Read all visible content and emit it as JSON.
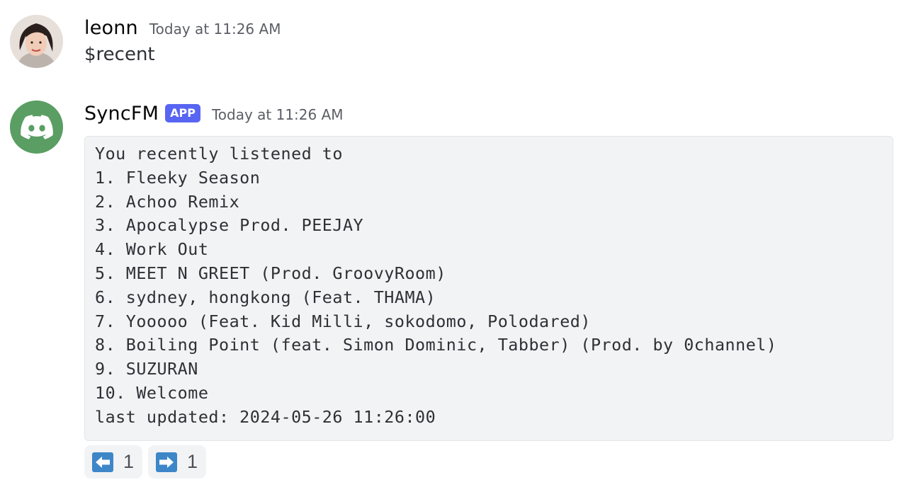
{
  "messages": [
    {
      "author": "leonn",
      "timestamp": "Today at 11:26 AM",
      "text": "$recent"
    },
    {
      "author": "SyncFM",
      "badge": "APP",
      "timestamp": "Today at 11:26 AM",
      "code_lines": [
        "You recently listened to",
        "1. Fleeky Season",
        "2. Achoo Remix",
        "3. Apocalypse Prod. PEEJAY",
        "4. Work Out",
        "5. MEET N GREET (Prod. GroovyRoom)",
        "6. sydney, hongkong (Feat. THAMA)",
        "7. Yooooo (Feat. Kid Milli, sokodomo, Polodared)",
        "8. Boiling Point (feat. Simon Dominic, Tabber) (Prod. by 0channel)",
        "9. SUZURAN",
        "10. Welcome",
        "last updated: 2024-05-26 11:26:00"
      ],
      "reactions": [
        {
          "emoji": "left-arrow-icon",
          "count": "1"
        },
        {
          "emoji": "right-arrow-icon",
          "count": "1"
        }
      ]
    }
  ],
  "colors": {
    "app_badge": "#5865f2",
    "bot_avatar": "#5a9e63",
    "arrow_emoji": "#3d86c8",
    "code_background": "#f2f3f5"
  }
}
